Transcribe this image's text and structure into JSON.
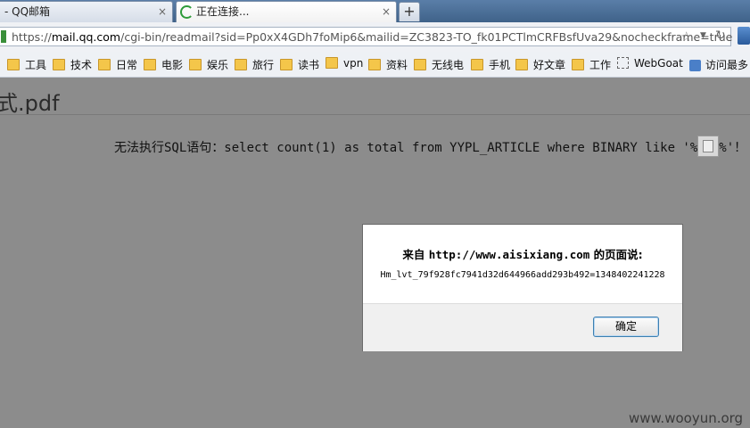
{
  "tabs": [
    {
      "label": "- QQ邮箱",
      "close": "×"
    },
    {
      "label": "正在连接...",
      "close": "×"
    }
  ],
  "new_tab_label": "+",
  "address": {
    "scheme": "https://",
    "domain": "mail.qq.com",
    "path": "/cgi-bin/readmail?sid=Pp0xX4GDh7foMip6&mailid=ZC3823-TO_fk01PCTlmCRFBsfUva29&nocheckframe=true"
  },
  "bookmarks": [
    "工具",
    "技术",
    "日常",
    "电影",
    "娱乐",
    "旅行",
    "读书",
    "vpn",
    "资料",
    "无线电",
    "手机",
    "好文章",
    "工作",
    "WebGoat",
    "访问最多"
  ],
  "page": {
    "pdf_title": "式.pdf",
    "sql_message_prefix": "无法执行SQL语句：select count(1) as total from YYPL_ARTICLE where BINARY like '%",
    "sql_message_suffix": "%'！"
  },
  "dialog": {
    "title_prefix": "来自",
    "title_url": "http://www.aisixiang.com",
    "title_suffix": "的页面说:",
    "message": "Hm_lvt_79f928fc7941d32d644966add293b492=1348402241228",
    "ok_label": "确定"
  },
  "watermark": "www.wooyun.org"
}
